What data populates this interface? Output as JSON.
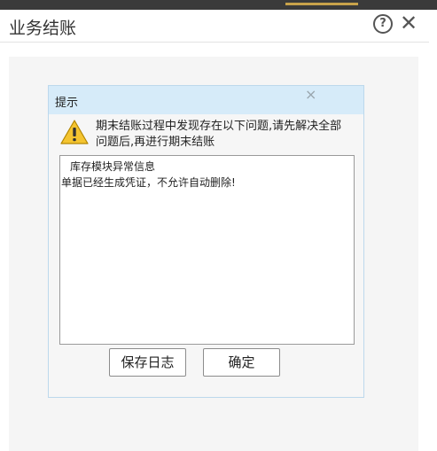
{
  "window": {
    "title": "业务结账",
    "help_icon": "?",
    "close_icon": "✕"
  },
  "dialog": {
    "title": "提示",
    "close_icon": "×",
    "message": "期末结账过程中发现存在以下问题,请先解决全部问题后,再进行期末结账",
    "log_heading": "库存模块异常信息",
    "log_line": "单据已经生成凭证，不允许自动删除!",
    "save_log_label": "保存日志",
    "ok_label": "确定"
  },
  "colors": {
    "dialog_header": "#d6ebf9",
    "warning_icon": "#f4c430"
  }
}
